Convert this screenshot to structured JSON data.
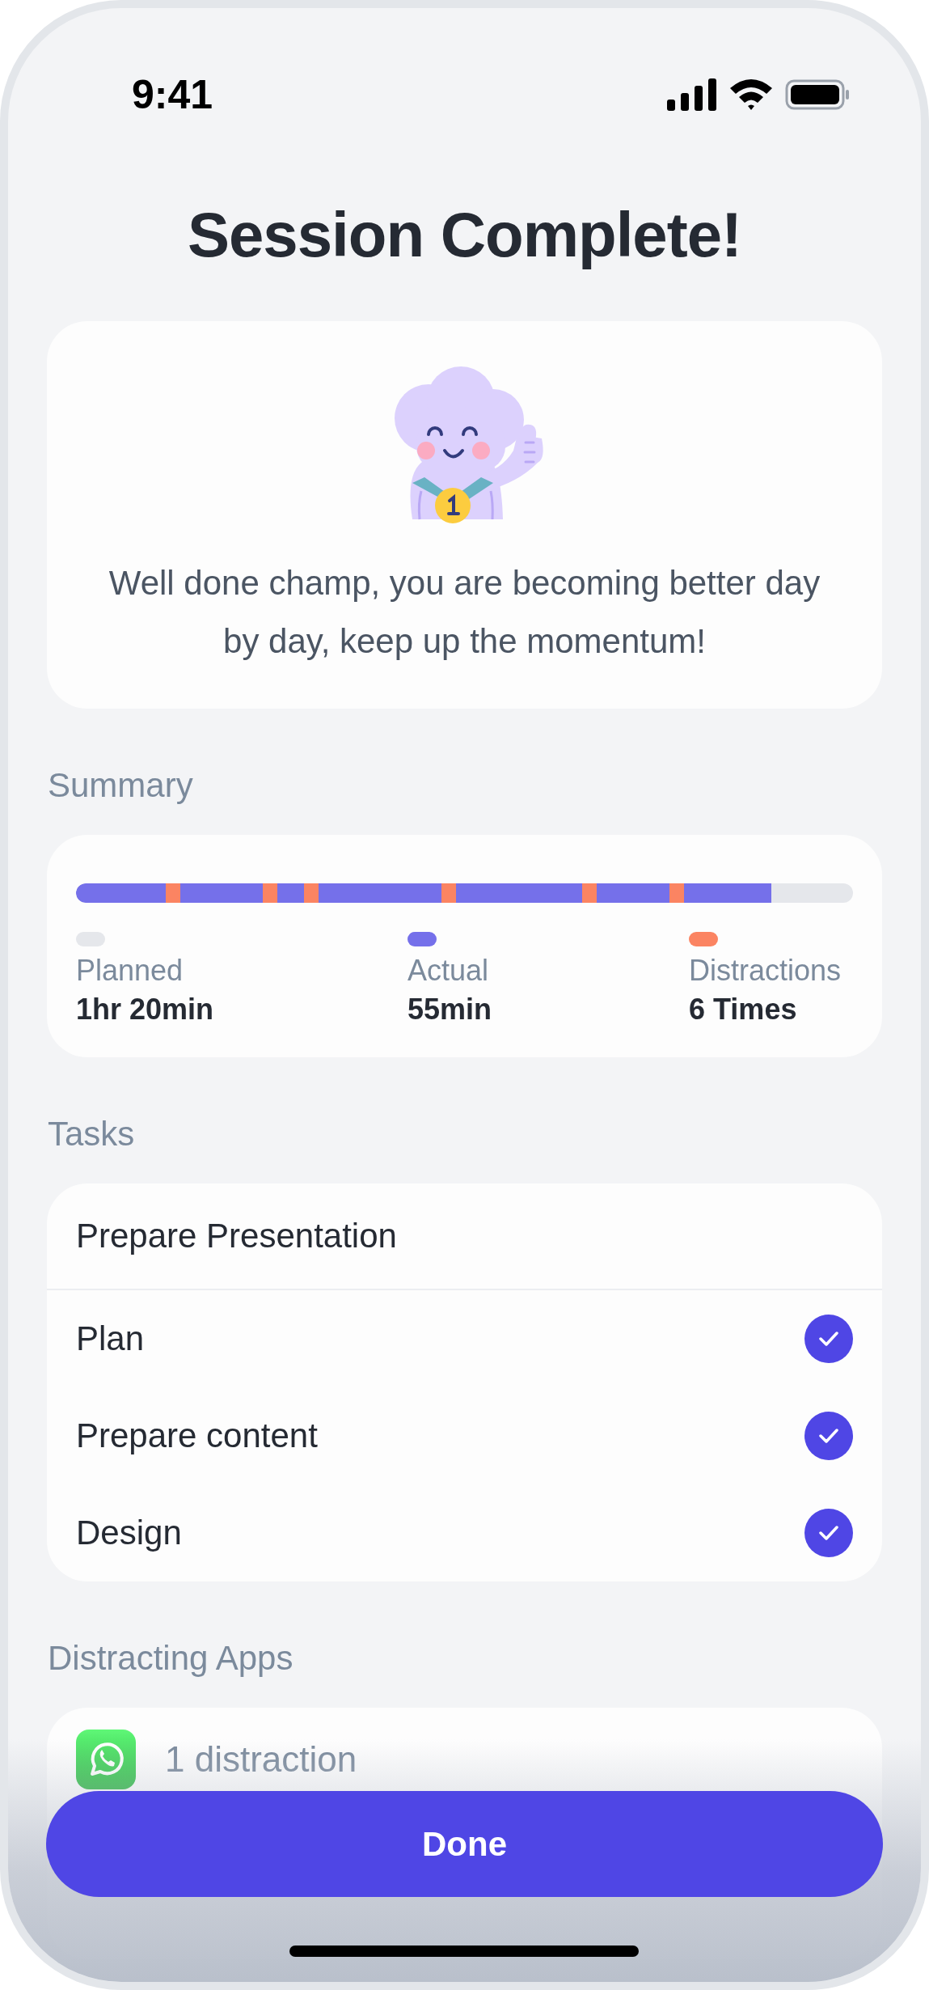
{
  "status_bar": {
    "time": "9:41"
  },
  "title": "Session Complete!",
  "message": "Well done champ, you are becoming better day by day, keep up the momentum!",
  "summary": {
    "heading": "Summary",
    "bar": {
      "level": 0.895,
      "distractions": [
        {
          "level": 0.115
        },
        {
          "level": 0.24
        },
        {
          "level": 0.293
        },
        {
          "level": 0.47
        },
        {
          "level": 0.651
        },
        {
          "level": 0.764
        }
      ]
    },
    "legend": [
      {
        "label": "Planned",
        "value": "1hr 20min",
        "color": "#e5e7eb"
      },
      {
        "label": "Actual",
        "value": "55min",
        "color": "#7570ea"
      },
      {
        "label": "Distractions",
        "value": "6 Times",
        "color": "#fb8462"
      }
    ]
  },
  "tasks": {
    "heading": "Tasks",
    "group": "Prepare Presentation",
    "items": [
      {
        "label": "Plan",
        "checked": true
      },
      {
        "label": "Prepare content",
        "checked": true
      },
      {
        "label": "Design",
        "checked": true
      }
    ]
  },
  "distracting_apps": {
    "heading": "Distracting Apps",
    "items": [
      {
        "kind": "chat",
        "count": "1 distraction"
      }
    ]
  },
  "done_button": "Done"
}
